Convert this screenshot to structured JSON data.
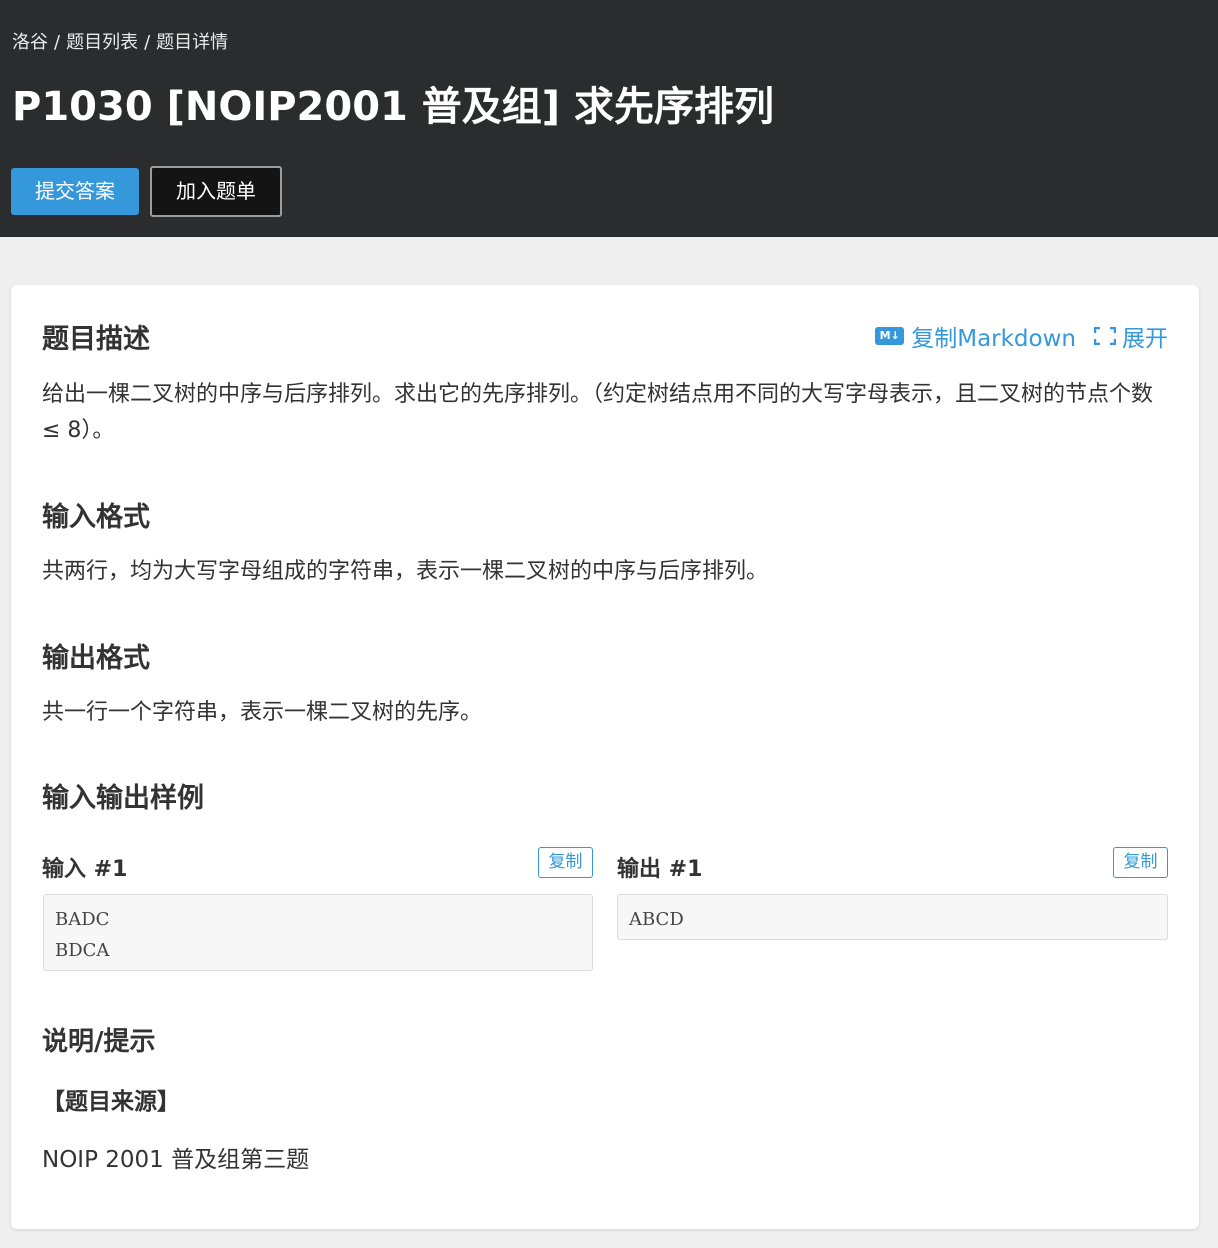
{
  "breadcrumb": {
    "site": "洛谷",
    "list": "题目列表",
    "current": "题目详情",
    "separator": "/"
  },
  "problem": {
    "title": "P1030 [NOIP2001 普及组] 求先序排列"
  },
  "actions": {
    "submit_label": "提交答案",
    "add_to_list_label": "加入题单"
  },
  "tools": {
    "copy_markdown_label": "复制Markdown",
    "expand_label": "展开",
    "markdown_icon_text": "M↓"
  },
  "sections": {
    "description_title": "题目描述",
    "description_text": "给出一棵二叉树的中序与后序排列。求出它的先序排列。（约定树结点用不同的大写字母表示，且二叉树的节点个数 ≤ 8）。",
    "input_format_title": "输入格式",
    "input_format_text": "共两行，均为大写字母组成的字符串，表示一棵二叉树的中序与后序排列。",
    "output_format_title": "输出格式",
    "output_format_text": "共一行一个字符串，表示一棵二叉树的先序。",
    "samples_title": "输入输出样例",
    "hint_title": "说明/提示"
  },
  "samples": {
    "input_label": "输入 #1",
    "output_label": "输出 #1",
    "copy_label": "复制",
    "input_lines": [
      "BADC",
      "BDCA"
    ],
    "output_lines": [
      "ABCD"
    ]
  },
  "hint": {
    "source_heading": "【题目来源】",
    "source_text": "NOIP 2001 普及组第三题"
  },
  "colors": {
    "header_bg": "#2b2c2e",
    "accent": "#3498db",
    "page_bg": "#efefef"
  }
}
